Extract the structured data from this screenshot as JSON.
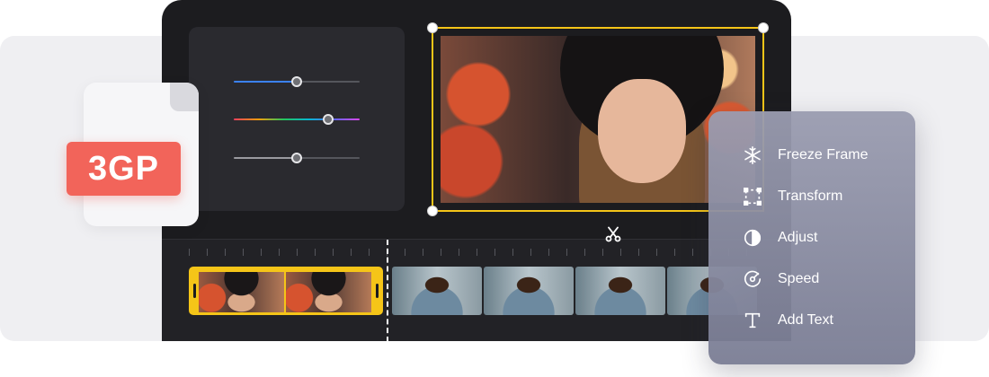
{
  "file_badge": {
    "format": "3GP"
  },
  "menu": {
    "items": [
      {
        "label": "Freeze Frame",
        "icon": "snowflake-icon"
      },
      {
        "label": "Transform",
        "icon": "transform-icon"
      },
      {
        "label": "Adjust",
        "icon": "contrast-icon"
      },
      {
        "label": "Speed",
        "icon": "speedometer-icon"
      },
      {
        "label": "Add Text",
        "icon": "text-icon"
      }
    ]
  },
  "adjust_panel": {
    "sliders": [
      {
        "value": 0.5,
        "color": "#3b82f6"
      },
      {
        "value": 0.75,
        "color": "rainbow"
      },
      {
        "value": 0.5,
        "color": "#9a9aa0"
      }
    ]
  },
  "colors": {
    "accent": "#f5c518",
    "badge": "#f2645a",
    "editor_bg": "#1c1c1f",
    "menu_bg": "#8f92a8"
  }
}
